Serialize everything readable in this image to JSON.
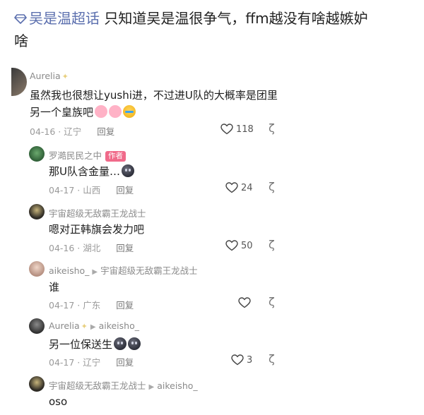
{
  "post": {
    "topic": "吴是温超话",
    "text_line1": " 只知道吴是温很争气，ffm越没有啥越嫉妒",
    "text_line2": "啥"
  },
  "comments": [
    {
      "name": "Aurelia",
      "text_line1": "虽然我也很想让yushi进，不过进U队的大概率是团里",
      "text_line2": "另一个皇族吧",
      "date": "04-16 · 辽宁",
      "reply": "回复",
      "likes": "118"
    },
    {
      "name": "罗澔民民之中",
      "author_tag": "作者",
      "text": "那U队含金量…",
      "date": "04-17 · 山西",
      "reply": "回复",
      "likes": "24"
    },
    {
      "name": "宇宙超级无敌霸王龙战士",
      "text": "嗯对正韩旗会发力吧",
      "date": "04-16 · 湖北",
      "reply": "回复",
      "likes": "50"
    },
    {
      "name": "aikeisho_",
      "reply_to": "宇宙超级无敌霸王龙战士",
      "text": "谁",
      "date": "04-17 · 广东",
      "reply": "回复",
      "likes": ""
    },
    {
      "name": "Aurelia",
      "reply_to": "aikeisho_",
      "text": "另一位保送生",
      "date": "04-17 · 辽宁",
      "reply": "回复",
      "likes": "3"
    },
    {
      "name": "宇宙超级无敌霸王龙战士",
      "reply_to": "aikeisho_",
      "text": "oso"
    }
  ]
}
